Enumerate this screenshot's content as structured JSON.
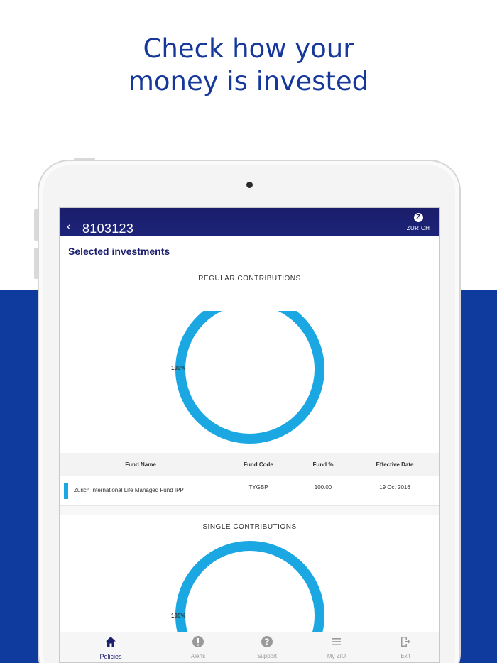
{
  "headline": {
    "line1": "Check how your",
    "line2": "money is invested"
  },
  "colors": {
    "brand_blue": "#0f3a9e",
    "app_bar": "#1b1f6d",
    "donut": "#1ba7e1"
  },
  "app_bar": {
    "back_icon": "chevron-left-icon",
    "policy_number": "8103123",
    "logo_text": "ZURICH",
    "logo_mark": "Z"
  },
  "section_title": "Selected investments",
  "regular": {
    "title": "REGULAR CONTRIBUTIONS",
    "label": "100%",
    "chart_data": {
      "type": "pie",
      "categories": [
        "Zurich International Life Managed Fund IPP"
      ],
      "values": [
        100
      ]
    }
  },
  "table": {
    "headers": [
      "Fund Name",
      "Fund Code",
      "Fund %",
      "Effective Date"
    ],
    "rows": [
      {
        "fund_name": "Zurich International Life Managed Fund IPP",
        "fund_code": "TYGBP",
        "fund_pct": "100.00",
        "effective_date": "19 Oct 2016"
      }
    ]
  },
  "single": {
    "title": "SINGLE CONTRIBUTIONS",
    "label": "100%"
  },
  "nav": [
    {
      "label": "Policies",
      "icon": "home-icon",
      "active": true
    },
    {
      "label": "Alerts",
      "icon": "alert-icon",
      "active": false
    },
    {
      "label": "Support",
      "icon": "help-icon",
      "active": false
    },
    {
      "label": "My ZIO",
      "icon": "menu-icon",
      "active": false
    },
    {
      "label": "Exit",
      "icon": "exit-icon",
      "active": false
    }
  ]
}
